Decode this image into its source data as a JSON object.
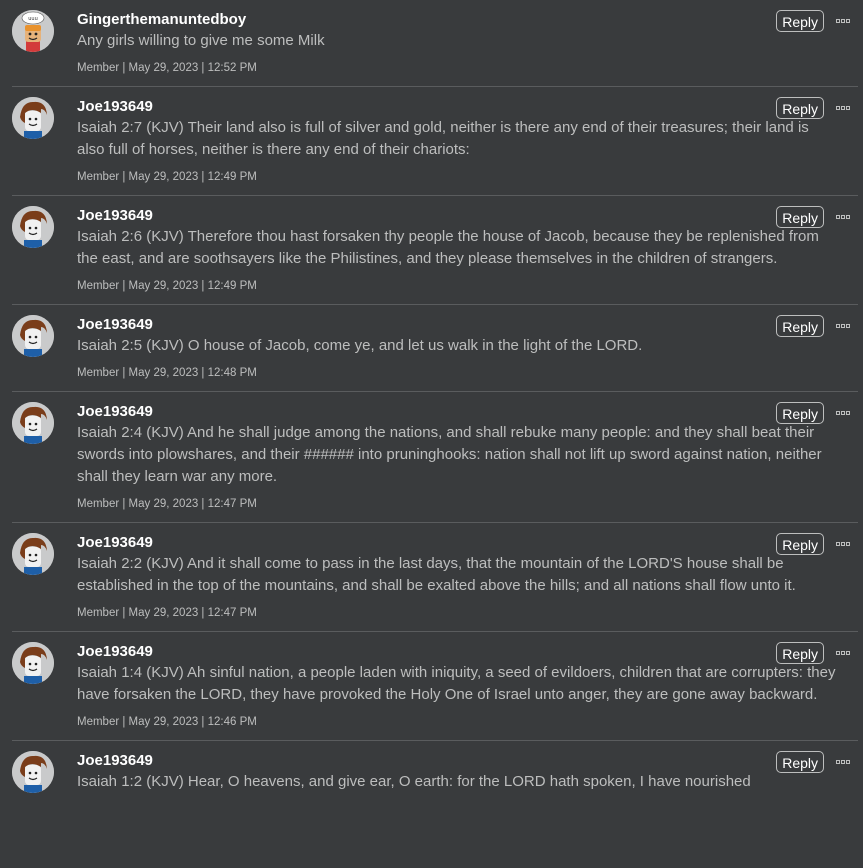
{
  "reply_label": "Reply",
  "comments": [
    {
      "username": "Gingerthemanuntedboy",
      "avatar": "custom-avatar-icon",
      "text": "Any girls willing to give me some Milk",
      "meta": "Member | May 29, 2023 | 12:52 PM"
    },
    {
      "username": "Joe193649",
      "avatar": "default-avatar-icon",
      "text": "Isaiah 2:7 (KJV) Their land also is full of silver and gold, neither is there any end of their treasures; their land is also full of horses, neither is there any end of their chariots:",
      "meta": "Member | May 29, 2023 | 12:49 PM"
    },
    {
      "username": "Joe193649",
      "avatar": "default-avatar-icon",
      "text": "Isaiah 2:6 (KJV) Therefore thou hast forsaken thy people the house of Jacob, because they be replenished from the east, and are soothsayers like the Philistines, and they please themselves in the children of strangers.",
      "meta": "Member | May 29, 2023 | 12:49 PM"
    },
    {
      "username": "Joe193649",
      "avatar": "default-avatar-icon",
      "text": "Isaiah 2:5 (KJV) O house of Jacob, come ye, and let us walk in the light of the LORD.",
      "meta": "Member | May 29, 2023 | 12:48 PM"
    },
    {
      "username": "Joe193649",
      "avatar": "default-avatar-icon",
      "text": "Isaiah 2:4 (KJV) And he shall judge among the nations, and shall rebuke many people: and they shall beat their swords into plowshares, and their ###### into pruninghooks: nation shall not lift up sword against nation, neither shall they learn war any more.",
      "meta": "Member | May 29, 2023 | 12:47 PM"
    },
    {
      "username": "Joe193649",
      "avatar": "default-avatar-icon",
      "text": "Isaiah 2:2 (KJV) And it shall come to pass in the last days, that the mountain of the LORD'S house shall be established in the top of the mountains, and shall be exalted above the hills; and all nations shall flow unto it.",
      "meta": "Member | May 29, 2023 | 12:47 PM"
    },
    {
      "username": "Joe193649",
      "avatar": "default-avatar-icon",
      "text": "Isaiah 1:4 (KJV) Ah sinful nation, a people laden with iniquity, a seed of evildoers, children that are corrupters: they have forsaken the LORD, they have provoked the Holy One of Israel unto anger, they are gone away backward.",
      "meta": "Member | May 29, 2023 | 12:46 PM"
    },
    {
      "username": "Joe193649",
      "avatar": "default-avatar-icon",
      "text": "Isaiah 1:2 (KJV) Hear, O heavens, and give ear, O earth: for the LORD hath spoken, I have nourished",
      "meta": ""
    }
  ]
}
